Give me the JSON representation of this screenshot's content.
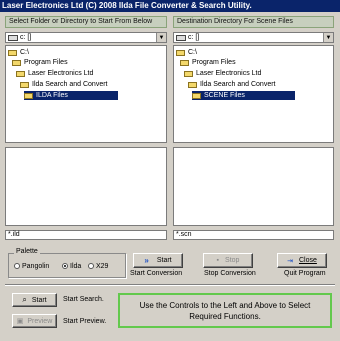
{
  "window": {
    "title": "Laser Electronics Ltd (C) 2008 Ilda File Converter & Search Utility."
  },
  "source": {
    "header": "Select Folder or Directory to Start From Below",
    "drive": "c: []",
    "tree": [
      "C:\\",
      "Program Files",
      "Laser Electronics Ltd",
      "Ilda Search and Convert",
      "ILDA Files"
    ],
    "mask": "*.ild"
  },
  "destination": {
    "header": "Destination Directory For Scene Files",
    "drive": "c: []",
    "tree": [
      "C:\\",
      "Program Files",
      "Laser Electronics Ltd",
      "Ilda Search and Convert",
      "SCENE Files"
    ],
    "mask": "*.scn"
  },
  "palette": {
    "label": "Palette",
    "options": [
      "Pangolin",
      "Ilda",
      "X29"
    ],
    "selected": "Ilda"
  },
  "conversion": {
    "start_button": "Start",
    "start_caption": "Start Conversion",
    "stop_button": "Stop",
    "stop_caption": "Stop Conversion",
    "close_button": "Close",
    "close_caption": "Quit Program"
  },
  "search": {
    "start_button": "Start",
    "start_caption": "Start Search.",
    "preview_button": "Preview",
    "preview_caption": "Start Preview."
  },
  "info_text": "Use the Controls to the Left and Above to Select Required Functions.",
  "colors": {
    "titlebar": "#0a246a",
    "info_border": "#63c94d",
    "selection": "#0a246a"
  }
}
